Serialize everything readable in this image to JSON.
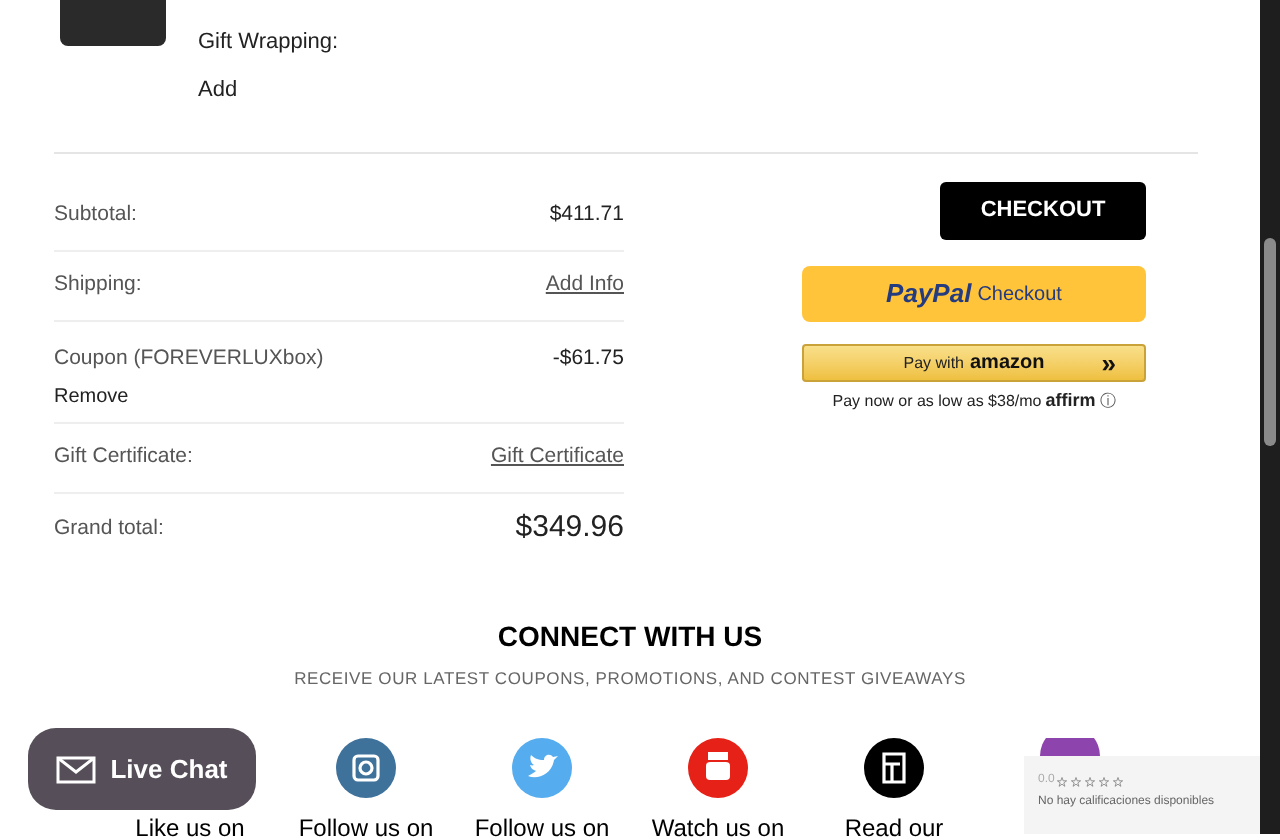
{
  "cart_item": {
    "gift_wrapping_label": "Gift Wrapping:",
    "gift_wrapping_action": "Add"
  },
  "totals": [
    {
      "kind": "plain",
      "label": "Subtotal:",
      "value": "$411.71"
    },
    {
      "kind": "link",
      "label": "Shipping:",
      "value": "Add Info"
    },
    {
      "kind": "coupon",
      "label": "Coupon (FOREVERLUXbox)",
      "action": "Remove",
      "value": "-$61.75"
    },
    {
      "kind": "link",
      "label": "Gift Certificate:",
      "value": "Gift Certificate"
    },
    {
      "kind": "grand",
      "label": "Grand total:",
      "value": "$349.96"
    }
  ],
  "checkout_button": "CHECKOUT",
  "paypal": {
    "brand": "PayPal",
    "label": "Checkout"
  },
  "amazon": {
    "prefix": "Pay with",
    "brand": "amazon",
    "arrows": "»"
  },
  "affirm": {
    "text": "Pay now or as low as $38/mo",
    "brand": "affirm",
    "info": "ⓘ"
  },
  "connect": {
    "title": "CONNECT WITH US",
    "subtitle": "RECEIVE OUR LATEST COUPONS, PROMOTIONS, AND CONTEST GIVEAWAYS",
    "items": [
      {
        "kind": "hidden",
        "label": "Like us on"
      },
      {
        "kind": "instagram",
        "label": "Follow us on"
      },
      {
        "kind": "twitter",
        "label": "Follow us on"
      },
      {
        "kind": "youtube",
        "label": "Watch us on"
      },
      {
        "kind": "blog",
        "label": "Read our"
      },
      {
        "kind": "purple"
      }
    ]
  },
  "live_chat": "Live Chat",
  "reviews": {
    "score": "0.0",
    "stars": 0,
    "text": "No hay calificaciones disponibles"
  }
}
